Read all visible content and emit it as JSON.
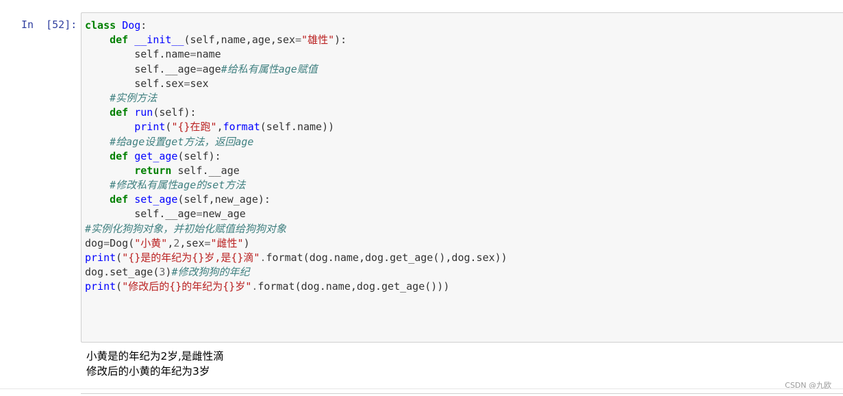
{
  "cell": {
    "prompt": "In  [52]:",
    "code_lines": [
      [
        {
          "t": "kw",
          "v": "class"
        },
        {
          "t": "p",
          "v": " "
        },
        {
          "t": "nm",
          "v": "Dog"
        },
        {
          "t": "p",
          "v": ":"
        }
      ],
      [
        {
          "t": "p",
          "v": "    "
        },
        {
          "t": "kw",
          "v": "def"
        },
        {
          "t": "p",
          "v": " "
        },
        {
          "t": "nm",
          "v": "__init__"
        },
        {
          "t": "p",
          "v": "(self,name,age,sex"
        },
        {
          "t": "op",
          "v": "="
        },
        {
          "t": "str",
          "v": "\"雄性\""
        },
        {
          "t": "p",
          "v": "):"
        }
      ],
      [
        {
          "t": "p",
          "v": "        self.name"
        },
        {
          "t": "op",
          "v": "="
        },
        {
          "t": "p",
          "v": "name"
        }
      ],
      [
        {
          "t": "p",
          "v": "        self.__age"
        },
        {
          "t": "op",
          "v": "="
        },
        {
          "t": "p",
          "v": "age"
        },
        {
          "t": "cm",
          "v": "#给私有属性age赋值"
        }
      ],
      [
        {
          "t": "p",
          "v": "        self.sex"
        },
        {
          "t": "op",
          "v": "="
        },
        {
          "t": "p",
          "v": "sex"
        }
      ],
      [
        {
          "t": "p",
          "v": "    "
        },
        {
          "t": "cm",
          "v": "#实例方法"
        }
      ],
      [
        {
          "t": "p",
          "v": "    "
        },
        {
          "t": "kw",
          "v": "def"
        },
        {
          "t": "p",
          "v": " "
        },
        {
          "t": "nm",
          "v": "run"
        },
        {
          "t": "p",
          "v": "(self):"
        }
      ],
      [
        {
          "t": "p",
          "v": "        "
        },
        {
          "t": "nm",
          "v": "print"
        },
        {
          "t": "p",
          "v": "("
        },
        {
          "t": "str",
          "v": "\"{}在跑\""
        },
        {
          "t": "p",
          "v": ","
        },
        {
          "t": "nm",
          "v": "format"
        },
        {
          "t": "p",
          "v": "(self.name))"
        }
      ],
      [
        {
          "t": "p",
          "v": "    "
        },
        {
          "t": "cm",
          "v": "#给age设置get方法，返回age"
        }
      ],
      [
        {
          "t": "p",
          "v": "    "
        },
        {
          "t": "kw",
          "v": "def"
        },
        {
          "t": "p",
          "v": " "
        },
        {
          "t": "nm",
          "v": "get_age"
        },
        {
          "t": "p",
          "v": "(self):"
        }
      ],
      [
        {
          "t": "p",
          "v": "        "
        },
        {
          "t": "kw",
          "v": "return"
        },
        {
          "t": "p",
          "v": " self.__age"
        }
      ],
      [
        {
          "t": "p",
          "v": "    "
        },
        {
          "t": "cm",
          "v": "#修改私有属性age的set方法"
        }
      ],
      [
        {
          "t": "p",
          "v": "    "
        },
        {
          "t": "kw",
          "v": "def"
        },
        {
          "t": "p",
          "v": " "
        },
        {
          "t": "nm",
          "v": "set_age"
        },
        {
          "t": "p",
          "v": "(self,new_age):"
        }
      ],
      [
        {
          "t": "p",
          "v": "        self.__age"
        },
        {
          "t": "op",
          "v": "="
        },
        {
          "t": "p",
          "v": "new_age"
        }
      ],
      [
        {
          "t": "cm",
          "v": "#实例化狗狗对象，并初始化赋值给狗狗对象"
        }
      ],
      [
        {
          "t": "p",
          "v": "dog"
        },
        {
          "t": "op",
          "v": "="
        },
        {
          "t": "p",
          "v": "Dog("
        },
        {
          "t": "str",
          "v": "\"小黄\""
        },
        {
          "t": "p",
          "v": ","
        },
        {
          "t": "op",
          "v": "2"
        },
        {
          "t": "p",
          "v": ",sex"
        },
        {
          "t": "op",
          "v": "="
        },
        {
          "t": "str",
          "v": "\"雌性\""
        },
        {
          "t": "p",
          "v": ")"
        }
      ],
      [
        {
          "t": "nm",
          "v": "print"
        },
        {
          "t": "p",
          "v": "("
        },
        {
          "t": "str",
          "v": "\"{}是的年纪为{}岁,是{}滴\""
        },
        {
          "t": "op",
          "v": "."
        },
        {
          "t": "p",
          "v": "format(dog.name,dog.get_age(),dog.sex))"
        }
      ],
      [
        {
          "t": "p",
          "v": "dog.set_age("
        },
        {
          "t": "op",
          "v": "3"
        },
        {
          "t": "p",
          "v": ")"
        },
        {
          "t": "cm",
          "v": "#修改狗狗的年纪"
        }
      ],
      [
        {
          "t": "nm",
          "v": "print"
        },
        {
          "t": "p",
          "v": "("
        },
        {
          "t": "str",
          "v": "\"修改后的{}的年纪为{}岁\""
        },
        {
          "t": "op",
          "v": "."
        },
        {
          "t": "p",
          "v": "format(dog.name,dog.get_age()))"
        }
      ]
    ],
    "output_lines": [
      "小黄是的年纪为2岁,是雌性滴",
      "修改后的小黄的年纪为3岁"
    ]
  },
  "watermark": "CSDN @九欧",
  "colors": {
    "keyword": "#008000",
    "name": "#0000ff",
    "string": "#ba2121",
    "comment": "#408080",
    "prompt": "#303f9f",
    "cell_background": "#f7f7f7",
    "cell_border": "#cfcfcf"
  }
}
